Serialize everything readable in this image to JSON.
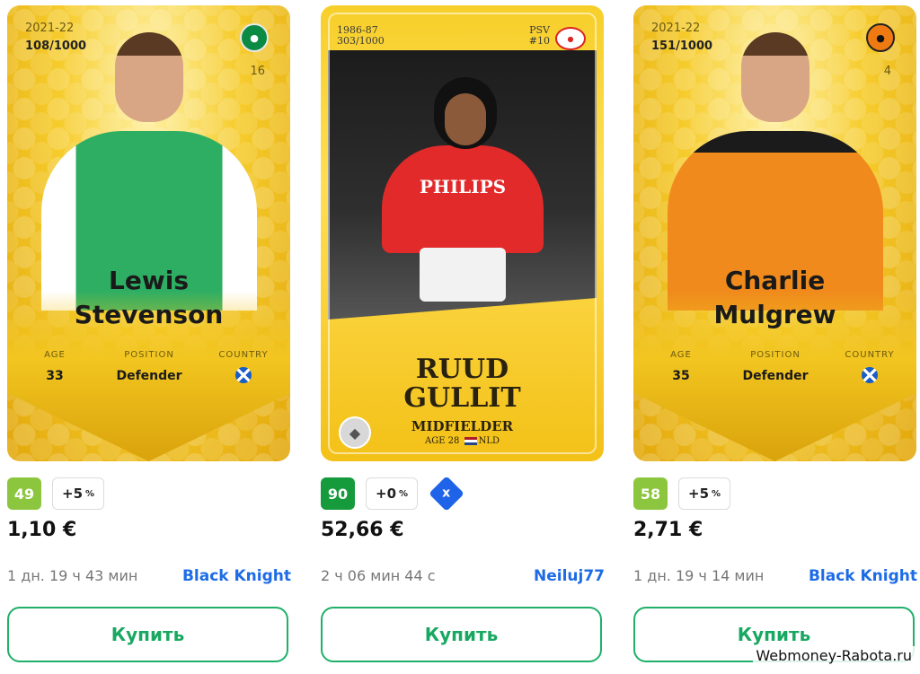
{
  "cards": [
    {
      "season": "2021-22",
      "serial": "108/1000",
      "shirt_number": "16",
      "name_line1": "Lewis",
      "name_line2": "Stevenson",
      "labels": {
        "age": "AGE",
        "position": "POSITION",
        "country": "COUNTRY"
      },
      "age": "33",
      "position": "Defender",
      "score": "49",
      "pct_value": "+5",
      "pct_sign": "%",
      "price": "1,10 €",
      "timer": "1 дн. 19 ч 43 мин",
      "seller": "Black Knight",
      "buy_label": "Купить"
    },
    {
      "season_line1": "1986-87",
      "season_line2": "303/1000",
      "club_line1": "PSV",
      "club_line2": "#10",
      "sponsor": "PHILIPS",
      "name_line1": "RUUD",
      "name_line2": "GULLIT",
      "position": "MIDFIELDER",
      "age_label": "AGE 28",
      "country": "NLD",
      "score": "90",
      "pct_value": "+0",
      "pct_sign": "%",
      "bid_icon": "x",
      "price": "52,66 €",
      "timer": "2 ч 06 мин 44 с",
      "seller": "Neiluj77",
      "buy_label": "Купить"
    },
    {
      "season": "2021-22",
      "serial": "151/1000",
      "shirt_number": "4",
      "name_line1": "Charlie",
      "name_line2": "Mulgrew",
      "labels": {
        "age": "AGE",
        "position": "POSITION",
        "country": "COUNTRY"
      },
      "age": "35",
      "position": "Defender",
      "score": "58",
      "pct_value": "+5",
      "pct_sign": "%",
      "price": "2,71 €",
      "timer": "1 дн. 19 ч 14 мин",
      "seller": "Black Knight",
      "buy_label": "Купить"
    }
  ],
  "watermark": "Webmoney-Rabota.ru",
  "colors": {
    "score_lime": "#8cc63f",
    "score_green": "#159a3c",
    "seller_blue": "#1d6be5",
    "buy_green": "#1fb06a",
    "card_gold": "#f6cc2c"
  }
}
